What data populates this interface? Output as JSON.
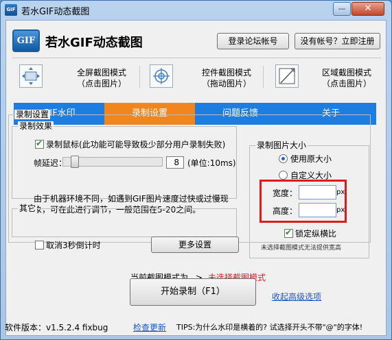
{
  "window": {
    "title": "若水GIF动态截图",
    "title_icon_text": "GIF",
    "minimize_symbol": "—",
    "close_symbol": "✕"
  },
  "header": {
    "logo_text": "GIF",
    "app_title": "若水GIF动态截图",
    "login_button": "登录论坛帐号",
    "register_button": "没有帐号？立即注册"
  },
  "capture_modes": [
    {
      "title": "全屏截图模式",
      "hint": "（点击图片）",
      "icon": "fullscreen-icon"
    },
    {
      "title": "控件截图模式",
      "hint": "（拖动图片）",
      "icon": "crosshair-icon"
    },
    {
      "title": "区域截图模式",
      "hint": "（点击图片）",
      "icon": "region-icon"
    }
  ],
  "tabs": [
    {
      "label": "GIF水印",
      "active": false
    },
    {
      "label": "录制设置",
      "active": true
    },
    {
      "label": "问题反馈",
      "active": false
    },
    {
      "label": "关于",
      "active": false
    }
  ],
  "record_settings": {
    "group_label": "录制设置",
    "effect": {
      "group_label": "录制效果",
      "record_mouse_label": "录制鼠标(此功能可能导致极少部分用户录制失败)",
      "record_mouse_checked": true,
      "delay_label": "帧延迟：",
      "delay_value": "8",
      "delay_unit": "(单位:10ms)",
      "note_line1": "由于机器环境不同，如遇到GIF图片速度过快或过慢现",
      "note_line2": "象，可在此进行调节，一般范围在5-20之间。"
    },
    "other": {
      "group_label": "其它",
      "cancel_countdown_label": "取消3秒倒计时",
      "cancel_countdown_checked": false,
      "more_settings_button": "更多设置"
    },
    "image_size": {
      "group_label": "录制图片大小",
      "use_original_label": "使用原大小",
      "custom_label": "自定义大小",
      "selected": "original",
      "width_label": "宽度：",
      "height_label": "高度：",
      "unit": "px",
      "width_value": "",
      "height_value": "",
      "lock_ratio_label": "锁定纵横比",
      "lock_ratio_checked": true,
      "notice": "未选择截图模式无法提供宽高"
    }
  },
  "footer": {
    "current_mode_label": "当前截图模式为",
    "arrow": ">",
    "current_mode_value": "未选择截图模式",
    "start_button": "开始录制（F1）",
    "collapse_link": "收起高级选项",
    "version_label": "软件版本：v1.5.2.4 fixbug",
    "check_update_link": "检查更新",
    "tips": "TIPS:为什么水印是横着的? 试选择开头不带\"@\"的字体!"
  },
  "colors": {
    "tab_blue": "#1e7de0",
    "tab_active_orange": "#f2861e",
    "highlight_red": "#e01a1a",
    "link_blue": "#1b55c7"
  }
}
